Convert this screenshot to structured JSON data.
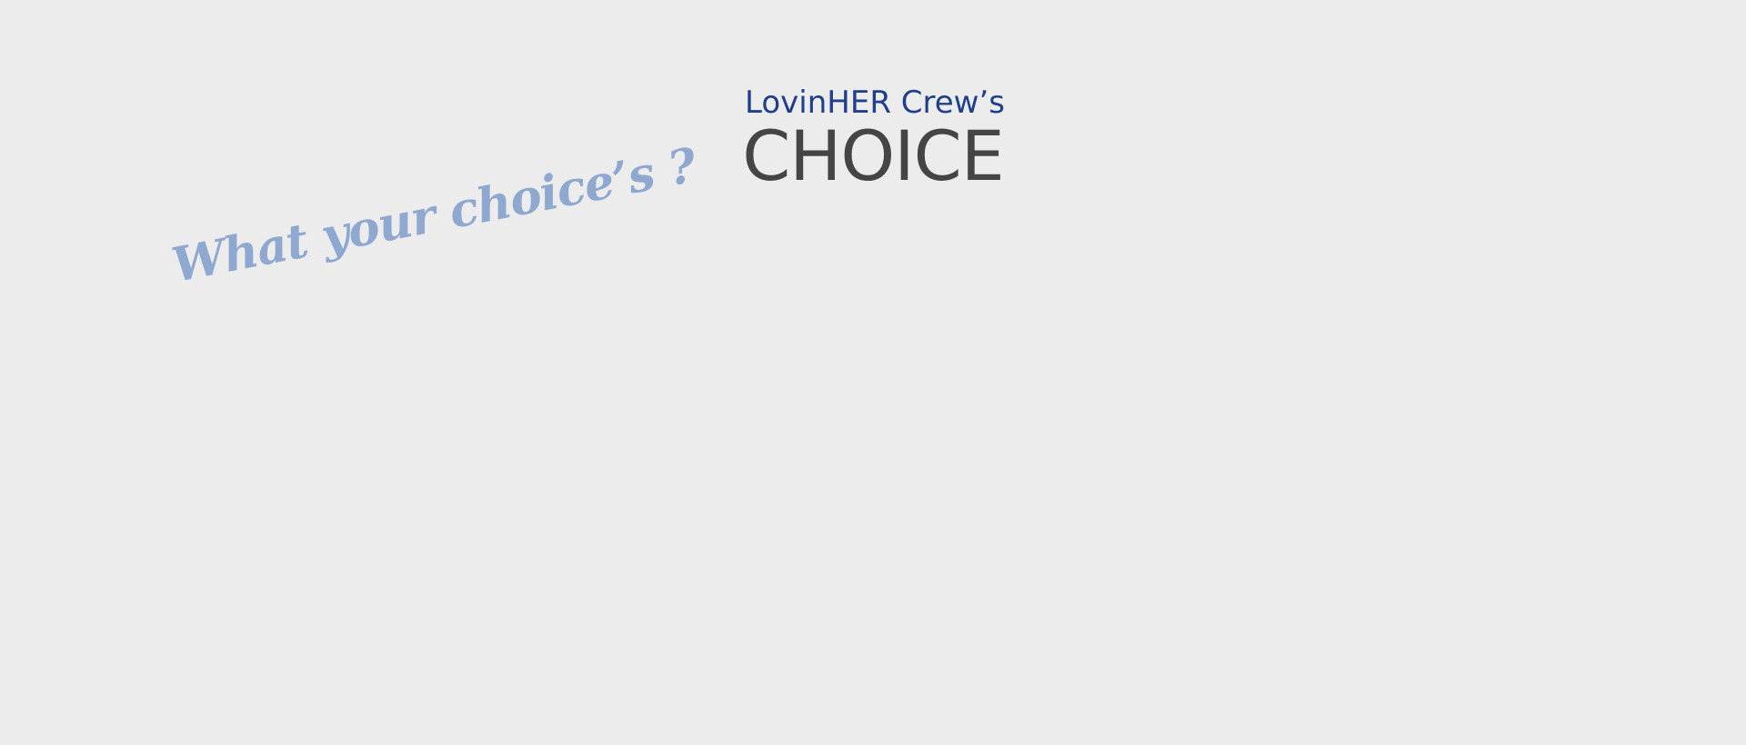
{
  "header": {
    "subtitle": "LovinHER Crew’s",
    "title": "CHOICE"
  },
  "tagline": {
    "text": "What your choice’s ?"
  },
  "colors": {
    "background": "#ececed",
    "subtitle": "#1f3f8a",
    "title": "#454545",
    "tagline": "#8fa8d0"
  }
}
